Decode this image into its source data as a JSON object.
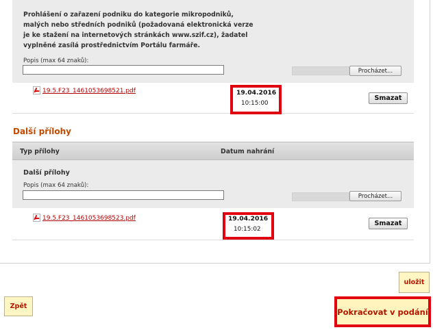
{
  "section1": {
    "declaration": "Prohlášení o zařazení podniku do kategorie mikropodniků, malých nebo středních podniků (požadovaná elektronická verze je ke stažení na internetových stránkách www.szif.cz), žadatel vyplněné zasílá prostřednictvím Portálu farmáře.",
    "popis_label": "Popis (max 64 znaků):",
    "description_value": "",
    "browse_label": "Procházet...",
    "file": {
      "name": "19.5.F23_1461053698521.pdf",
      "date": "19.04.2016",
      "time": "10:15:00",
      "delete_label": "Smazat"
    }
  },
  "section2": {
    "title": "Další přílohy",
    "col_type": "Typ přílohy",
    "col_date": "Datum nahrání",
    "row_label": "Další přílohy",
    "popis_label": "Popis (max 64 znaků):",
    "description_value": "",
    "browse_label": "Procházet...",
    "file": {
      "name": "19.5.F23_1461053698523.pdf",
      "date": "19.04.2016",
      "time": "10:15:02",
      "delete_label": "Smazat"
    }
  },
  "buttons": {
    "save": "uložit",
    "back": "Zpět",
    "continue": "Pokračovat v podání"
  },
  "colors": {
    "accent_red": "#e0000f",
    "link_red": "#b30000",
    "section_title": "#c04a00",
    "button_bg": "#fff6c4"
  }
}
